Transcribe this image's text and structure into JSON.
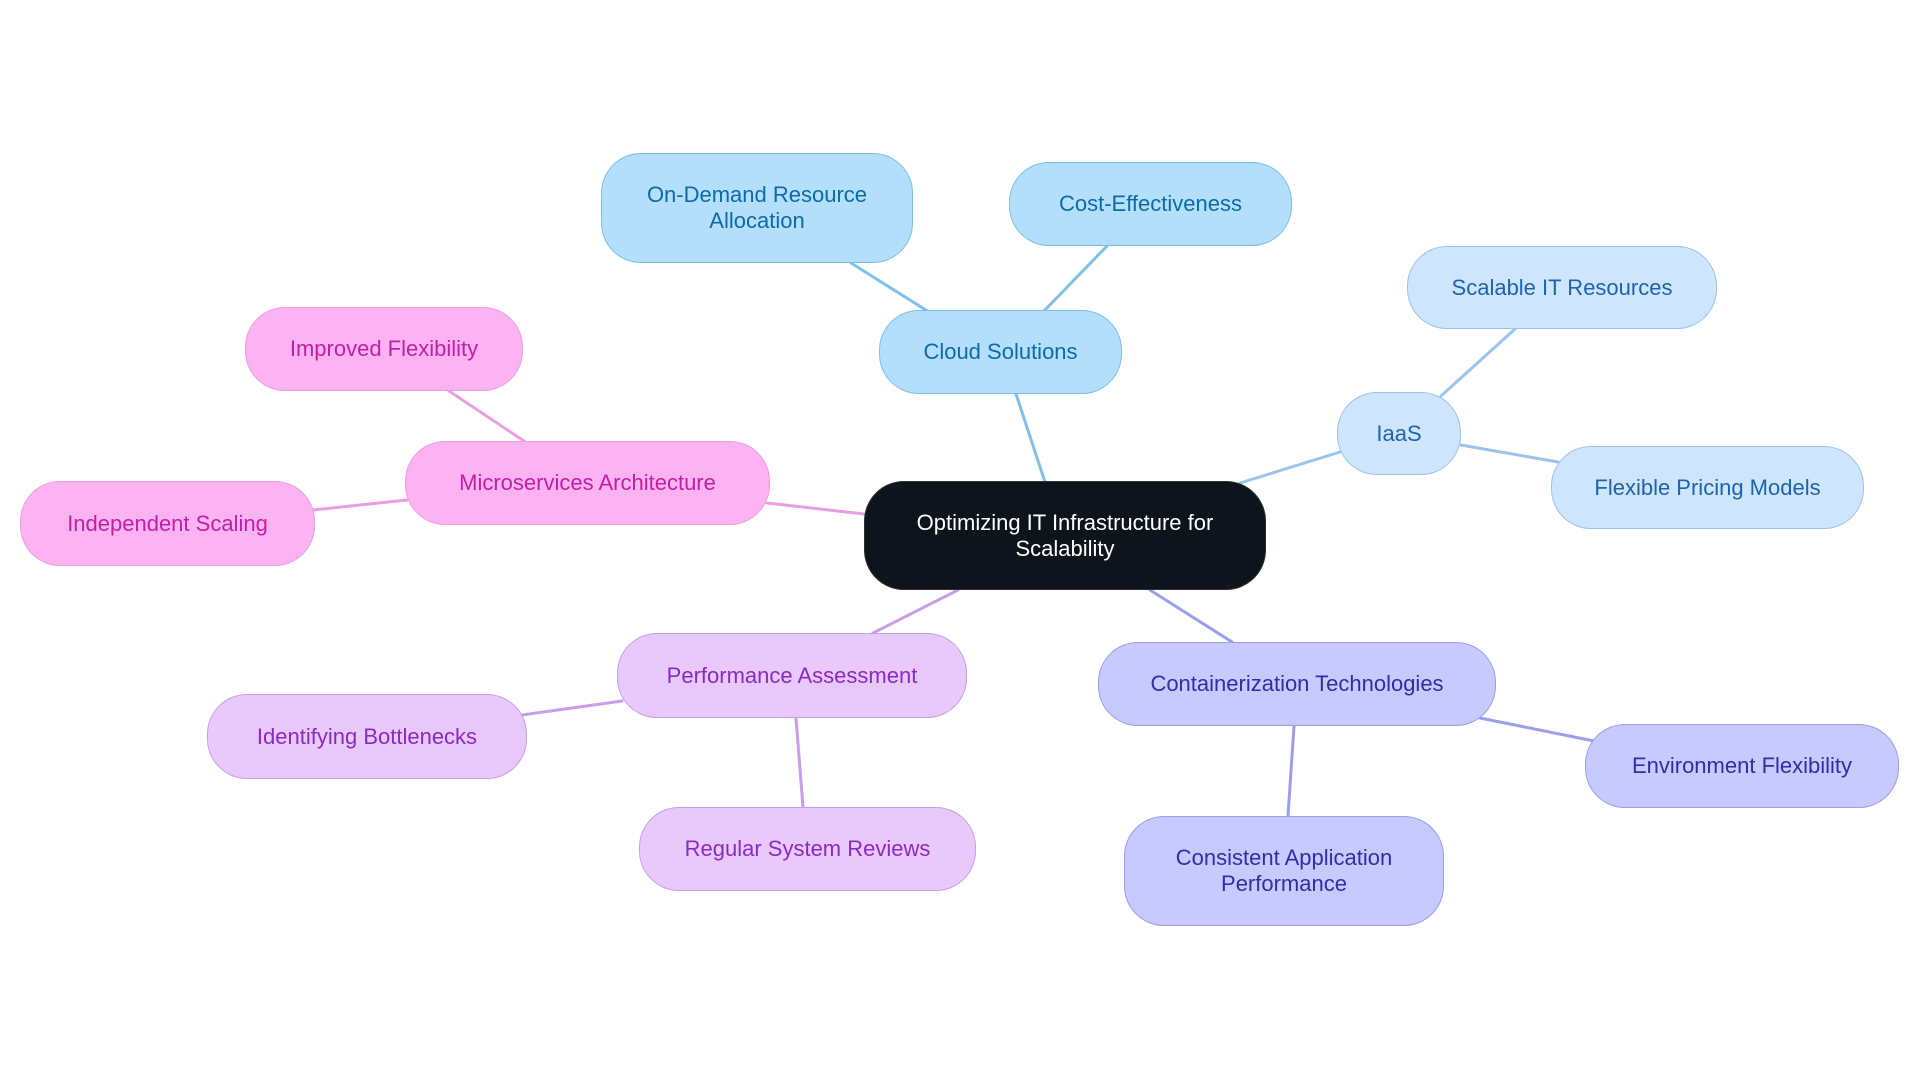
{
  "diagram": {
    "type": "mindmap",
    "root": {
      "id": "root",
      "label": "Optimizing IT Infrastructure for Scalability",
      "colors": {
        "fill": "#0d141b",
        "border": "#2a2f36",
        "text": "#ffffff"
      }
    },
    "branches": [
      {
        "id": "cloud",
        "label": "Cloud Solutions",
        "colors": {
          "fill": "#b3dffc",
          "border": "#7fbde6",
          "text": "#0d6aa6",
          "edge": "#7fbfe8"
        },
        "children": [
          {
            "id": "on-demand",
            "label": "On-Demand Resource Allocation"
          },
          {
            "id": "cost-eff",
            "label": "Cost-Effectiveness"
          }
        ]
      },
      {
        "id": "iaas",
        "label": "IaaS",
        "colors": {
          "fill": "#cfe5fb",
          "border": "#9cc3ec",
          "text": "#1d63ad",
          "edge": "#9cc3ec"
        },
        "children": [
          {
            "id": "scalable-it",
            "label": "Scalable IT Resources"
          },
          {
            "id": "flex-pricing",
            "label": "Flexible Pricing Models"
          }
        ]
      },
      {
        "id": "container",
        "label": "Containerization Technologies",
        "colors": {
          "fill": "#c7caff",
          "border": "#9b9ee8",
          "text": "#2e2ea8",
          "edge": "#9b9ee8"
        },
        "children": [
          {
            "id": "env-flex",
            "label": "Environment Flexibility"
          },
          {
            "id": "consistent",
            "label": "Consistent Application Performance"
          }
        ]
      },
      {
        "id": "perf",
        "label": "Performance Assessment",
        "colors": {
          "fill": "#e9c8fc",
          "border": "#c99ee8",
          "text": "#8a2bbf",
          "edge": "#c89ee8"
        },
        "children": [
          {
            "id": "identifying",
            "label": "Identifying Bottlenecks"
          },
          {
            "id": "regular",
            "label": "Regular System Reviews"
          }
        ]
      },
      {
        "id": "micro",
        "label": "Microservices Architecture",
        "colors": {
          "fill": "#fcb3f2",
          "border": "#eb9ee0",
          "text": "#c21fa8",
          "edge": "#e89ee0"
        },
        "children": [
          {
            "id": "improved-flex",
            "label": "Improved Flexibility"
          },
          {
            "id": "independent",
            "label": "Independent Scaling"
          }
        ]
      }
    ]
  }
}
